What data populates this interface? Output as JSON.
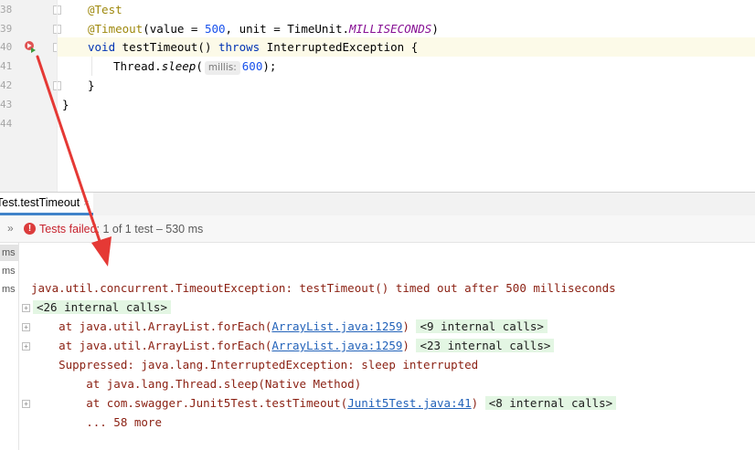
{
  "editor": {
    "line_numbers": [
      "38",
      "39",
      "40",
      "41",
      "42",
      "43",
      "44"
    ],
    "line38_annotation": "@Test",
    "line39_annotation": "@Timeout",
    "line39_open": "(value = ",
    "line39_value": "500",
    "line39_mid": ", unit = TimeUnit.",
    "line39_unit": "MILLISECONDS",
    "line39_close": ")",
    "line40_void": "void",
    "line40_name": " testTimeout() ",
    "line40_throws": "throws",
    "line40_rest": " InterruptedException {",
    "line41_call": "Thread.",
    "line41_method": "sleep",
    "line41_paren": "(",
    "line41_hint": "millis:",
    "line41_value": "600",
    "line41_close": ");",
    "line42": "}",
    "line43": "}"
  },
  "run_tab": {
    "label": "Test.testTimeout",
    "close": "×"
  },
  "status": {
    "chevron": "»",
    "error_glyph": "!",
    "failed_label": "Tests failed",
    "detail": ": 1 of 1 test – 530 ms"
  },
  "tree": {
    "items": [
      "ms",
      "ms",
      "ms"
    ]
  },
  "console": {
    "exception": "java.util.concurrent.TimeoutException: testTimeout() timed out after 500 milliseconds",
    "internal_26": "<26 internal calls>",
    "frame1_prefix": "    at java.util.ArrayList.forEach(",
    "frame1_link": "ArrayList.java:1259",
    "frame1_suffix": ")",
    "internal_9": "<9 internal calls>",
    "frame2_prefix": "    at java.util.ArrayList.forEach(",
    "frame2_link": "ArrayList.java:1259",
    "frame2_suffix": ")",
    "internal_23": "<23 internal calls>",
    "suppressed": "    Suppressed: java.lang.InterruptedException: sleep interrupted",
    "frame3": "        at java.lang.Thread.sleep(Native Method)",
    "frame4_prefix": "        at com.swagger.Junit5Test.testTimeout(",
    "frame4_link": "Junit5Test.java:41",
    "frame4_suffix": ")",
    "internal_8": "<8 internal calls>",
    "more": "        ... 58 more"
  },
  "colors": {
    "error": "#c7222d",
    "link": "#2262b9",
    "annotation_arrow": "#e53935",
    "internal_bg": "#e3f6e3",
    "keyword": "#0033b3",
    "number": "#1750eb"
  }
}
